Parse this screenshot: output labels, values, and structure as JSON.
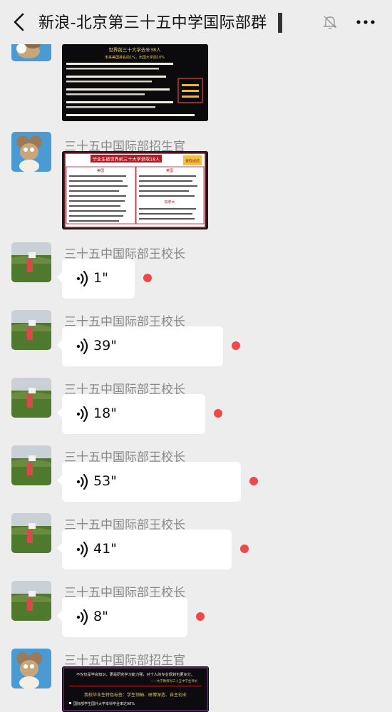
{
  "header": {
    "title": "新浪-北京第三十五中学国际部群",
    "back_icon": "chevron-left-icon",
    "mute_icon": "bell-off-icon",
    "more_icon": "more-dots-icon"
  },
  "colors": {
    "background": "#ededed",
    "bubble": "#ffffff",
    "unread_dot": "#f04848",
    "sender": "#888888"
  },
  "messages": [
    {
      "type": "image",
      "sender": "",
      "avatar": "mouse-cartoon-avatar",
      "image": {
        "headline": "世界前三十大学去年38人",
        "line2": "未来美国排名前1%，出国大学前10%"
      }
    },
    {
      "type": "image",
      "sender": "三十五中国际部招生官",
      "avatar": "mouse-cartoon-avatar",
      "image": {
        "headline": "毕业生被世界前三十大学录取18人",
        "badge": "录取成绩",
        "col1": "美国",
        "col2": "英国",
        "col3": "加拿大"
      }
    },
    {
      "type": "voice",
      "sender": "三十五中国际部王校长",
      "avatar": "field-landscape-avatar",
      "duration": "1\"",
      "length_ratio": 0.2
    },
    {
      "type": "voice",
      "sender": "三十五中国际部王校长",
      "avatar": "field-landscape-avatar",
      "duration": "39\"",
      "length_ratio": 0.7
    },
    {
      "type": "voice",
      "sender": "三十五中国际部王校长",
      "avatar": "field-landscape-avatar",
      "duration": "18\"",
      "length_ratio": 0.5
    },
    {
      "type": "voice",
      "sender": "三十五中国际部王校长",
      "avatar": "field-landscape-avatar",
      "duration": "53\"",
      "length_ratio": 0.8
    },
    {
      "type": "voice",
      "sender": "三十五中国际部王校长",
      "avatar": "field-landscape-avatar",
      "duration": "41\"",
      "length_ratio": 0.72
    },
    {
      "type": "voice",
      "sender": "三十五中国际部王校长",
      "avatar": "field-landscape-avatar",
      "duration": "8\"",
      "length_ratio": 0.35
    },
    {
      "type": "image",
      "sender": "三十五中国际部招生官",
      "avatar": "mouse-cartoon-avatar",
      "image": {
        "quote": "不仅仅是学会知识，更是研究学习能力强，对个人的专业规划也更充分。",
        "quote_src": "——大学教师对三十五中学生评价",
        "subhead": "我校毕业生特色标签：学生领袖、研博深造、自主创业",
        "bullet": "国际部学生国外大学本科毕业率达98%"
      }
    }
  ]
}
